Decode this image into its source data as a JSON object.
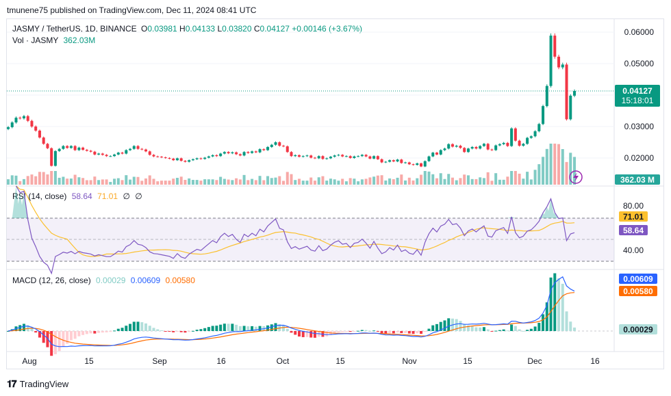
{
  "header": {
    "published": "tmunene75 published on TradingView.com, Dec 11, 2024 08:41 UTC"
  },
  "main": {
    "symbol": "JASMY / TetherUS, 1D, BINANCE",
    "o_label": "O",
    "o_value": "0.03981",
    "h_label": "H",
    "h_value": "0.04133",
    "l_label": "L",
    "l_value": "0.03820",
    "c_label": "C",
    "c_value": "0.04127",
    "change": "+0.00146 (+3.67%)",
    "vol_label": "Vol · JASMY",
    "vol_value": "362.03M",
    "price_axis": [
      "0.06000",
      "0.05000",
      "0.03000",
      "0.02000"
    ],
    "last_price": "0.04127",
    "countdown": "15:18:01",
    "vol_badge": "362.03 M"
  },
  "rsi": {
    "label": "RSI (14, close)",
    "value": "58.64",
    "ma": "71.01",
    "extra1": "∅",
    "extra2": "∅",
    "axis": [
      "80.00",
      "40.00"
    ],
    "badge_ma": "71.01",
    "badge_value": "58.64"
  },
  "macd": {
    "label": "MACD (12, 26, close)",
    "hist": "0.00029",
    "macd": "0.00609",
    "signal": "0.00580",
    "badge_macd": "0.00609",
    "badge_signal": "0.00580",
    "badge_hist": "0.00029"
  },
  "time_axis": [
    "Aug",
    "15",
    "Sep",
    "16",
    "Oct",
    "15",
    "Nov",
    "15",
    "Dec",
    "16"
  ],
  "brand": {
    "name": "TradingView"
  },
  "colors": {
    "up": "#089981",
    "down": "#f23645",
    "rsi": "#7e57c2",
    "rsi_ma": "#fbc02d",
    "macd": "#2962ff",
    "signal": "#ff6d00"
  },
  "chart_data": [
    {
      "type": "candlestick",
      "title": "JASMY / TetherUS, 1D, BINANCE",
      "x_range": [
        "2024-07-20",
        "2024-12-11"
      ],
      "ylim": [
        0.012,
        0.06
      ],
      "ohlc_last": {
        "o": 0.03981,
        "h": 0.04133,
        "l": 0.0382,
        "c": 0.04127
      },
      "close": [
        0.0298,
        0.0313,
        0.0328,
        0.0326,
        0.0333,
        0.0318,
        0.03,
        0.0287,
        0.0265,
        0.0245,
        0.0231,
        0.0175,
        0.0222,
        0.0229,
        0.0238,
        0.0232,
        0.0238,
        0.0225,
        0.0233,
        0.0226,
        0.0223,
        0.022,
        0.0211,
        0.0214,
        0.021,
        0.0206,
        0.0206,
        0.0211,
        0.0217,
        0.0214,
        0.0225,
        0.0229,
        0.0238,
        0.0229,
        0.0227,
        0.0221,
        0.021,
        0.0205,
        0.0204,
        0.0202,
        0.02,
        0.0198,
        0.0193,
        0.0199,
        0.0191,
        0.0188,
        0.0193,
        0.0196,
        0.0199,
        0.0197,
        0.0201,
        0.0205,
        0.0209,
        0.0206,
        0.0214,
        0.0219,
        0.0215,
        0.0218,
        0.0212,
        0.0208,
        0.0219,
        0.0216,
        0.0221,
        0.0218,
        0.0228,
        0.0225,
        0.0235,
        0.0242,
        0.025,
        0.0239,
        0.0237,
        0.0219,
        0.0206,
        0.0209,
        0.0204,
        0.0206,
        0.0208,
        0.0201,
        0.0199,
        0.0206,
        0.0197,
        0.0199,
        0.0204,
        0.0208,
        0.021,
        0.0205,
        0.0206,
        0.02,
        0.0205,
        0.0206,
        0.021,
        0.0205,
        0.0198,
        0.0206,
        0.0196,
        0.0186,
        0.0188,
        0.0193,
        0.0189,
        0.0195,
        0.0184,
        0.0186,
        0.018,
        0.0178,
        0.0183,
        0.0173,
        0.019,
        0.0205,
        0.0217,
        0.0211,
        0.0225,
        0.023,
        0.0244,
        0.0236,
        0.0239,
        0.0232,
        0.0219,
        0.023,
        0.0235,
        0.023,
        0.0238,
        0.0245,
        0.0227,
        0.0225,
        0.024,
        0.0244,
        0.0248,
        0.0238,
        0.0294,
        0.0255,
        0.0239,
        0.0245,
        0.0264,
        0.0269,
        0.0285,
        0.0308,
        0.0365,
        0.0429,
        0.0589,
        0.0522,
        0.0488,
        0.0497,
        0.0323,
        0.0398,
        0.0413
      ],
      "volume_max_label": "362.03M"
    },
    {
      "type": "line",
      "title": "RSI (14, close)",
      "series": [
        {
          "name": "RSI",
          "last": 58.64
        },
        {
          "name": "RSI MA",
          "last": 71.01
        }
      ],
      "bands": [
        70,
        50,
        30
      ],
      "ylim": [
        25,
        95
      ]
    },
    {
      "type": "line",
      "title": "MACD (12, 26, close)",
      "series": [
        {
          "name": "MACD",
          "last": 0.00609
        },
        {
          "name": "Signal",
          "last": 0.0058
        },
        {
          "name": "Histogram",
          "last": 0.00029
        }
      ]
    }
  ]
}
